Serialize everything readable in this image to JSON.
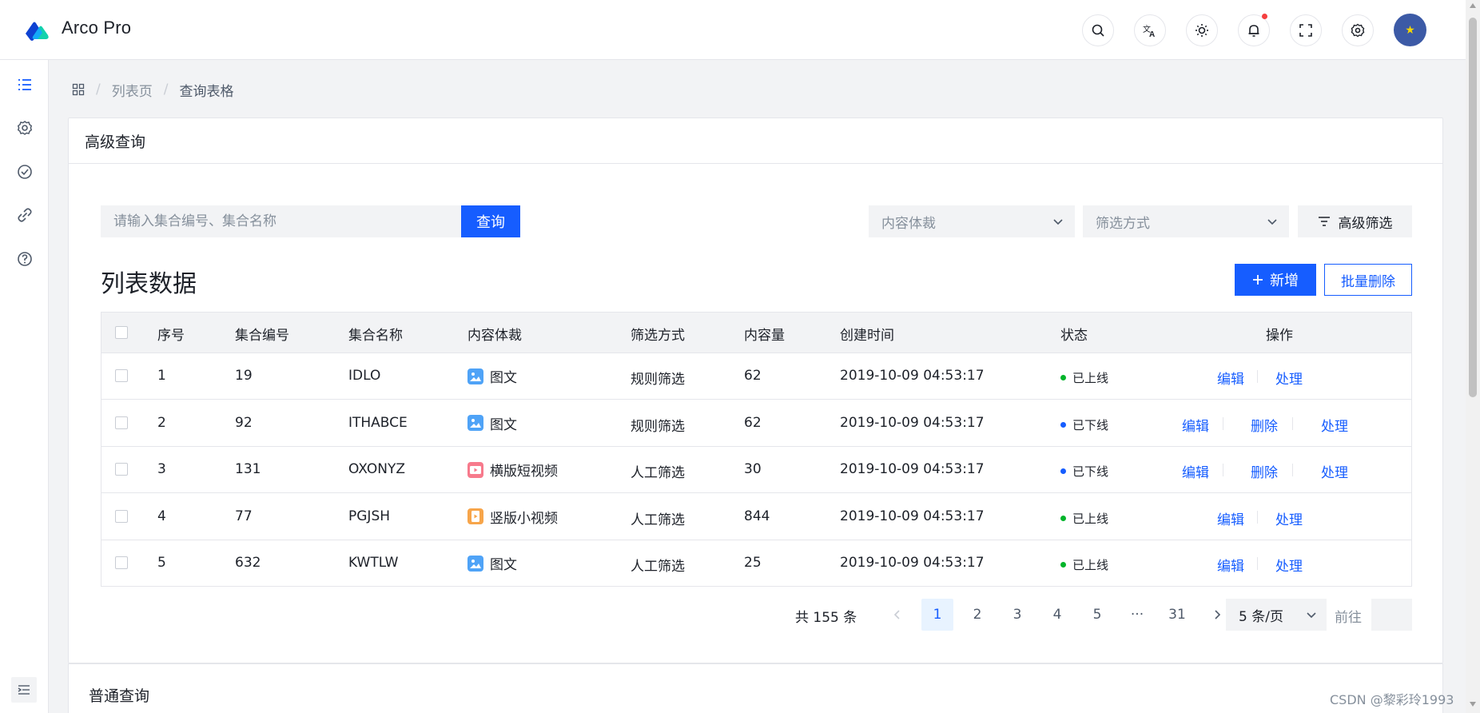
{
  "app": {
    "brand": "Arco Pro"
  },
  "header": {
    "icons": [
      "search-icon",
      "language-icon",
      "theme-icon",
      "notification-icon",
      "fullscreen-icon",
      "settings-icon"
    ],
    "avatar_icon": "star-icon"
  },
  "sidebar": {
    "items": [
      "list-icon",
      "settings-icon",
      "check-circle-icon",
      "link-icon",
      "help-icon"
    ],
    "collapse_icon": "collapse-menu-icon"
  },
  "breadcrumb": {
    "home_icon": "apps-icon",
    "level1": "列表页",
    "level2": "查询表格",
    "sep": "/"
  },
  "card": {
    "title": "高级查询",
    "search": {
      "placeholder": "请输入集合编号、集合名称",
      "button": "查询"
    },
    "filters": {
      "content_type": {
        "placeholder": "内容体裁"
      },
      "filter_type": {
        "placeholder": "筛选方式"
      },
      "advanced_label": "高级筛选"
    },
    "list_title": "列表数据",
    "add_button": "新增",
    "batch_delete_button": "批量删除"
  },
  "table": {
    "columns": [
      "序号",
      "集合编号",
      "集合名称",
      "内容体裁",
      "筛选方式",
      "内容量",
      "创建时间",
      "状态",
      "操作"
    ],
    "rows": [
      {
        "index": "1",
        "id": "19",
        "name": "IDLO",
        "content_type": "图文",
        "type_icon": "image-text",
        "filter": "规则筛选",
        "count": "62",
        "created": "2019-10-09 04:53:17",
        "status": "已上线",
        "status_color": "#00b42a",
        "actions": [
          "编辑",
          "处理"
        ]
      },
      {
        "index": "2",
        "id": "92",
        "name": "ITHABCE",
        "content_type": "图文",
        "type_icon": "image-text",
        "filter": "规则筛选",
        "count": "62",
        "created": "2019-10-09 04:53:17",
        "status": "已下线",
        "status_color": "#165dff",
        "actions": [
          "编辑",
          "删除",
          "处理"
        ]
      },
      {
        "index": "3",
        "id": "131",
        "name": "OXONYZ",
        "content_type": "横版短视频",
        "type_icon": "horizontal-video",
        "filter": "人工筛选",
        "count": "30",
        "created": "2019-10-09 04:53:17",
        "status": "已下线",
        "status_color": "#165dff",
        "actions": [
          "编辑",
          "删除",
          "处理"
        ]
      },
      {
        "index": "4",
        "id": "77",
        "name": "PGJSH",
        "content_type": "竖版小视频",
        "type_icon": "vertical-video",
        "filter": "人工筛选",
        "count": "844",
        "created": "2019-10-09 04:53:17",
        "status": "已上线",
        "status_color": "#00b42a",
        "actions": [
          "编辑",
          "处理"
        ]
      },
      {
        "index": "5",
        "id": "632",
        "name": "KWTLW",
        "content_type": "图文",
        "type_icon": "image-text",
        "filter": "人工筛选",
        "count": "25",
        "created": "2019-10-09 04:53:17",
        "status": "已上线",
        "status_color": "#00b42a",
        "actions": [
          "编辑",
          "处理"
        ]
      }
    ]
  },
  "pagination": {
    "total": "共 155 条",
    "pages": [
      "1",
      "2",
      "3",
      "4",
      "5",
      "···",
      "31"
    ],
    "current": "1",
    "page_size": "5 条/页",
    "goto_label": "前往"
  },
  "card2": {
    "title": "普通查询"
  },
  "watermark": "CSDN @黎彩玲1993",
  "colors": {
    "primary": "#165dff",
    "success": "#00b42a",
    "bg": "#f2f3f5"
  }
}
